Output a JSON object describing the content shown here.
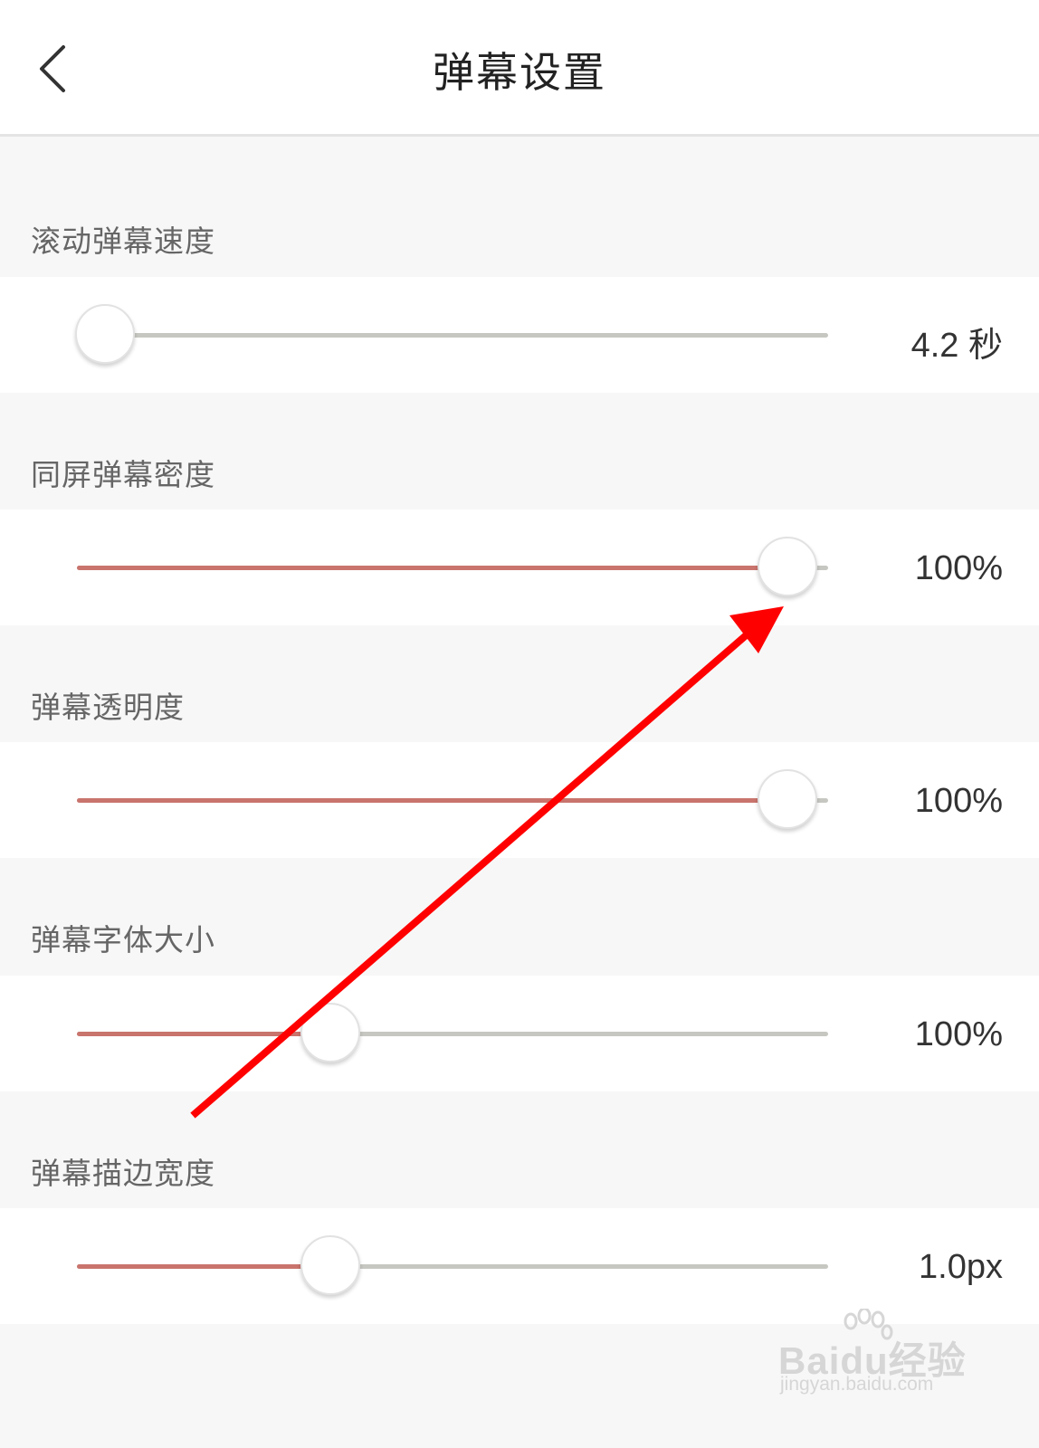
{
  "header": {
    "title": "弹幕设置"
  },
  "settings": [
    {
      "label": "滚动弹幕速度",
      "value_text": "4.2 秒",
      "level": 0.0
    },
    {
      "label": "同屏弹幕密度",
      "value_text": "100%",
      "level": 1.0
    },
    {
      "label": "弹幕透明度",
      "value_text": "100%",
      "level": 1.0
    },
    {
      "label": "弹幕字体大小",
      "value_text": "100%",
      "level": 0.33
    },
    {
      "label": "弹幕描边宽度",
      "value_text": "1.0px",
      "level": 0.33
    }
  ],
  "colors": {
    "accent": "#c9746d",
    "track": "#c7c7c2",
    "annotation_arrow": "#ff0000"
  },
  "icons": {
    "back": "chevron-left-icon",
    "watermark": "baidu-paw-icon"
  },
  "watermark": {
    "logo": "Baidu经验",
    "url": "jingyan.baidu.com"
  }
}
